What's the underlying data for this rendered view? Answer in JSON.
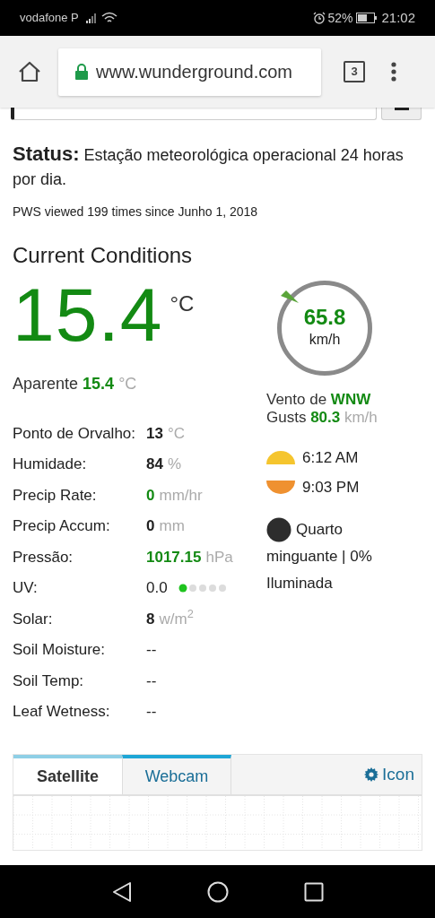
{
  "status_bar": {
    "carrier": "vodafone P",
    "battery": "52%",
    "time": "21:02"
  },
  "browser": {
    "url": "www.wunderground.com",
    "tab_count": "3"
  },
  "status": {
    "label": "Status:",
    "text": "Estação meteorológica operacional 24 horas por dia."
  },
  "views": "PWS viewed 199 times since Junho 1, 2018",
  "section_title": "Current Conditions",
  "temperature": {
    "value": "15.4",
    "unit": "°C",
    "feels_label": "Aparente",
    "feels_value": "15.4",
    "feels_unit": "°C"
  },
  "wind": {
    "speed": "65.8",
    "unit": "km/h",
    "from_label": "Vento de",
    "direction": "WNW",
    "gusts_label": "Gusts",
    "gusts": "80.3",
    "gusts_unit": "km/h"
  },
  "rows": [
    {
      "label": "Ponto de Orvalho:",
      "value": "13",
      "unit": "°C",
      "kind": "bold"
    },
    {
      "label": "Humidade:",
      "value": "84",
      "unit": "%",
      "kind": "bold"
    },
    {
      "label": "Precip Rate:",
      "value": "0",
      "unit": "mm/hr",
      "kind": "green"
    },
    {
      "label": "Precip Accum:",
      "value": "0",
      "unit": "mm",
      "kind": "bold"
    },
    {
      "label": "Pressão:",
      "value": "1017.15",
      "unit": "hPa",
      "kind": "green"
    },
    {
      "label": "UV:",
      "value": "0.0",
      "kind": "meter",
      "level": 0.2
    },
    {
      "label": "Solar:",
      "value": "8",
      "unit": "w/m$^{2}$",
      "kind": "bold"
    },
    {
      "label": "Soil Moisture:",
      "value": "--",
      "kind": "plain"
    },
    {
      "label": "Soil Temp:",
      "value": "--",
      "kind": "plain"
    },
    {
      "label": "Leaf Wetness:",
      "value": "--",
      "kind": "plain"
    }
  ],
  "sun": {
    "sunrise": "6:12 AM",
    "sunset": "9:03 PM"
  },
  "moon": {
    "first_line": "Quarto",
    "rest": "minguante | 0% Iluminada"
  },
  "tabs": [
    {
      "label": "Satellite",
      "selected": true
    },
    {
      "label": "Webcam",
      "selected": false
    }
  ],
  "icon_link": "Icon"
}
